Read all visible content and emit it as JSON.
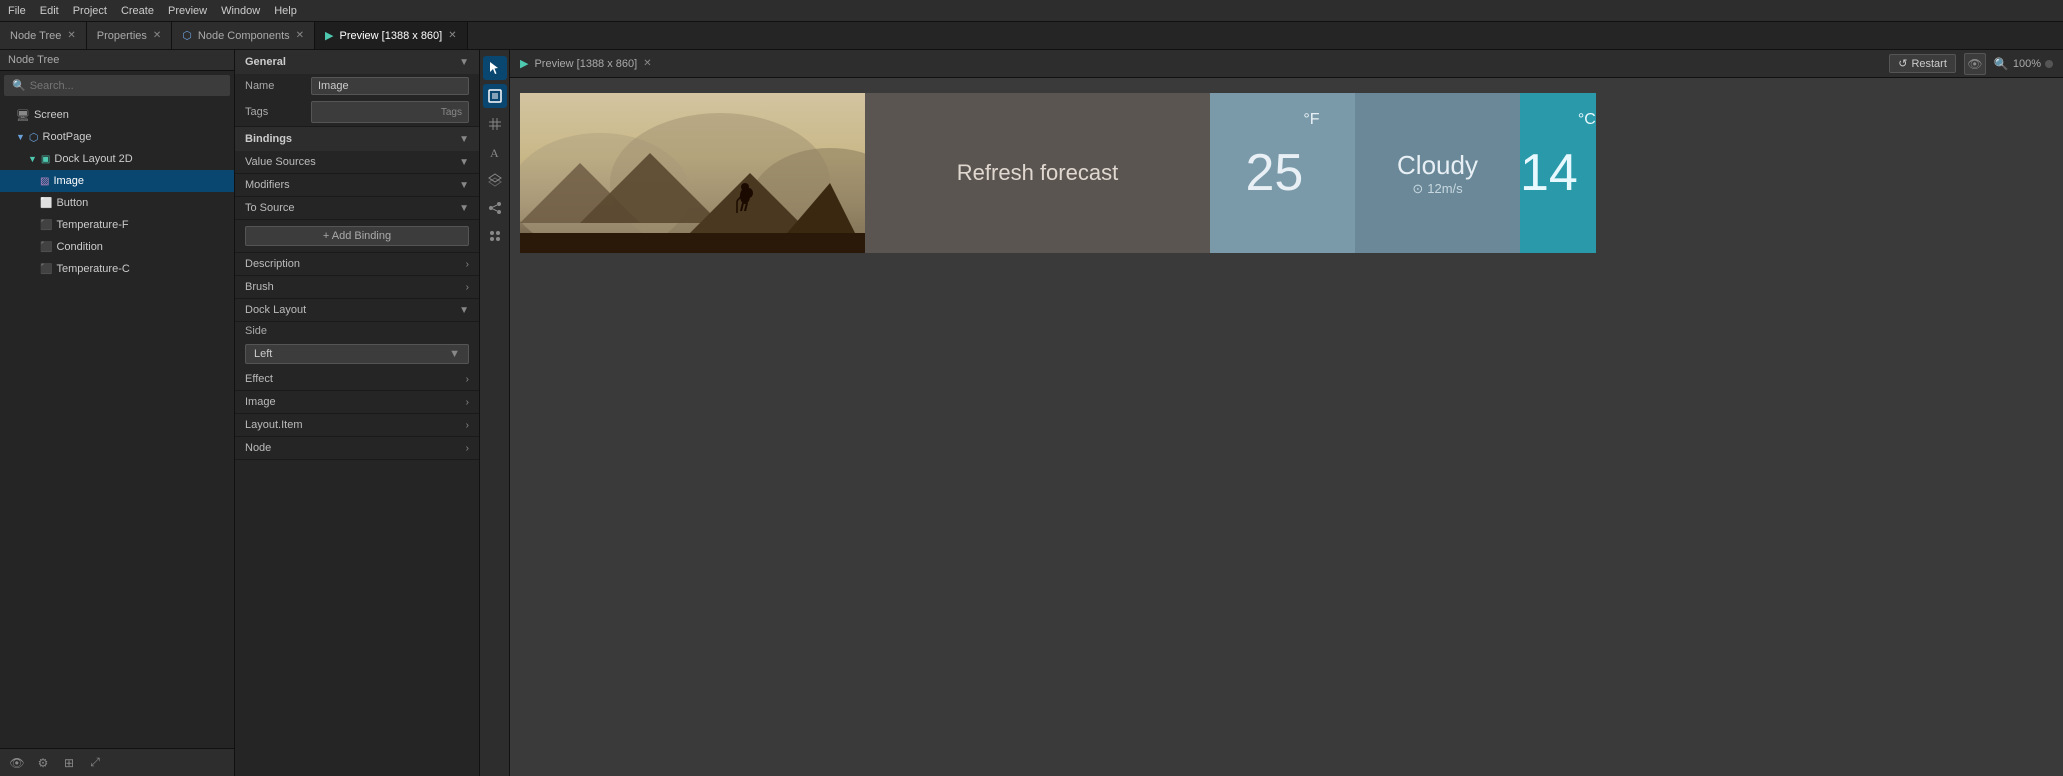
{
  "menubar": {
    "items": [
      "File",
      "Edit",
      "Project",
      "Create",
      "Preview",
      "Window",
      "Help"
    ]
  },
  "tabs": {
    "nodeTree": {
      "label": "Node Tree",
      "active": false,
      "closable": true
    },
    "properties": {
      "label": "Properties",
      "active": false,
      "closable": true
    },
    "nodeComponents": {
      "label": "Node Components",
      "active": false,
      "closable": true
    },
    "preview": {
      "label": "Preview [1388 x 860]",
      "active": true,
      "closable": true
    }
  },
  "nodeTree": {
    "searchPlaceholder": "Search...",
    "nodes": [
      {
        "id": "screen",
        "label": "Screen",
        "level": 0,
        "icon": "monitor",
        "selected": false
      },
      {
        "id": "rootpage",
        "label": "RootPage",
        "level": 1,
        "icon": "page",
        "selected": false
      },
      {
        "id": "docklayout2d",
        "label": "Dock Layout 2D",
        "level": 2,
        "icon": "dock",
        "selected": false
      },
      {
        "id": "image",
        "label": "Image",
        "level": 3,
        "icon": "image",
        "selected": true
      },
      {
        "id": "button",
        "label": "Button",
        "level": 3,
        "icon": "button",
        "selected": false
      },
      {
        "id": "temperature-f",
        "label": "Temperature-F",
        "level": 3,
        "icon": "label",
        "selected": false
      },
      {
        "id": "condition",
        "label": "Condition",
        "level": 3,
        "icon": "condition",
        "selected": false
      },
      {
        "id": "temperature-c",
        "label": "Temperature-C",
        "level": 3,
        "icon": "label",
        "selected": false
      }
    ]
  },
  "properties": {
    "sectionTitle": "General",
    "nameLabel": "Name",
    "nameValue": "Image",
    "tagsLabel": "Tags",
    "tagsButtonLabel": "Tags",
    "bindingsTitle": "Bindings",
    "valueSources": "Value Sources",
    "modifiers": "Modifiers",
    "toSource": "To Source",
    "addBinding": "+ Add Binding",
    "description": "Description",
    "brush": "Brush",
    "dockLayout": "Dock Layout",
    "sideLabel": "Side",
    "sideValue": "Left",
    "effect": "Effect",
    "image": "Image",
    "layoutItem": "Layout.Item",
    "node": "Node"
  },
  "preview": {
    "title": "Preview [1388 x 860]",
    "restartLabel": "Restart",
    "zoomLevel": "100%",
    "weather": {
      "refreshText": "Refresh forecast",
      "tempF": "25",
      "tempFUnit": "°F",
      "condition": "Cloudy",
      "conditionSub": "12m/s",
      "tempC": "14",
      "tempCUnit": "°C"
    }
  },
  "toolbar": {
    "search_icon": "🔍",
    "tools": [
      "cursor",
      "select",
      "grid",
      "text",
      "layers",
      "share",
      "group"
    ]
  }
}
